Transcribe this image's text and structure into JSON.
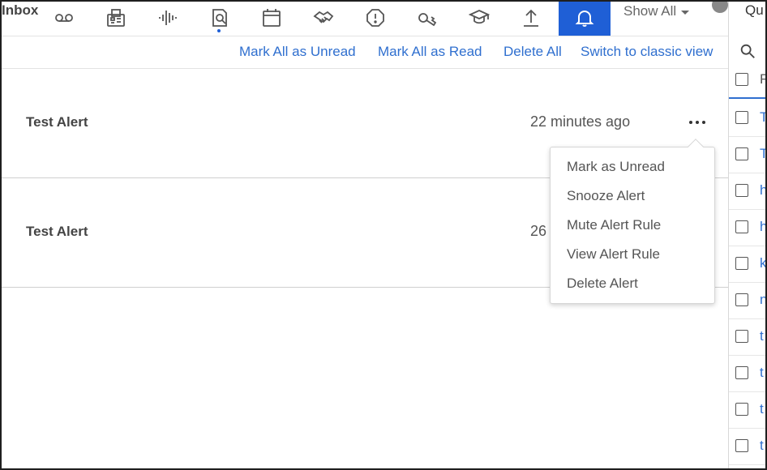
{
  "toolbar": {
    "inbox_label": "Inbox",
    "icons": [
      "voicemail-icon",
      "fax-icon",
      "audio-waveform-icon",
      "document-search-icon",
      "calendar-icon",
      "handshake-icon",
      "alert-octagon-icon",
      "key-icon",
      "graduation-cap-icon",
      "upload-icon",
      "bell-icon"
    ],
    "show_all_label": "Show All",
    "active_color": "#1f5fd6"
  },
  "actions": {
    "mark_all_unread": "Mark All as Unread",
    "mark_all_read": "Mark All as Read",
    "delete_all": "Delete All",
    "switch_classic": "Switch to classic view",
    "link_color": "#2f6fcf"
  },
  "alerts": [
    {
      "title": "Test Alert",
      "time": "22 minutes ago"
    },
    {
      "title": "Test Alert",
      "time": "26"
    }
  ],
  "context_menu": {
    "items": [
      "Mark as Unread",
      "Snooze Alert",
      "Mute Alert Rule",
      "View Alert Rule",
      "Delete Alert"
    ]
  },
  "right_panel": {
    "tab_label": "Qu",
    "header_letter": "F",
    "row_letters": [
      "T",
      "T",
      "h",
      "h",
      "k",
      "n",
      "t",
      "t",
      "t",
      "t"
    ]
  }
}
